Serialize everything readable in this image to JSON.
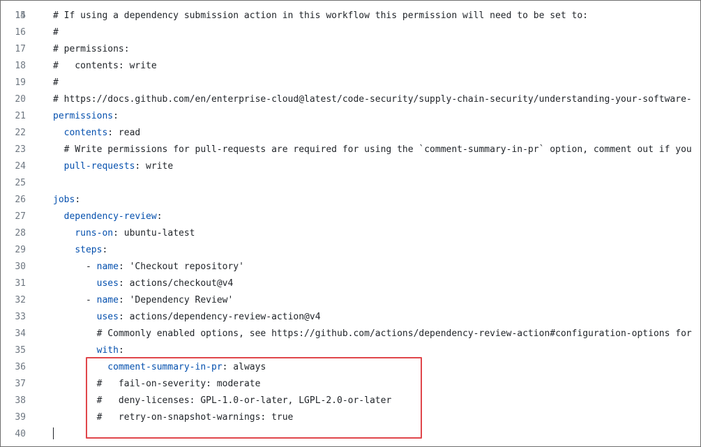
{
  "editor": {
    "first_partial_line": "14",
    "lines": [
      {
        "num": "15",
        "indent": "",
        "parts": [
          {
            "t": "# If using a dependency submission action in this workflow this permission will need to be set to:",
            "c": "cmt"
          }
        ]
      },
      {
        "num": "16",
        "indent": "",
        "parts": [
          {
            "t": "#",
            "c": "cmt"
          }
        ]
      },
      {
        "num": "17",
        "indent": "",
        "parts": [
          {
            "t": "# permissions:",
            "c": "cmt"
          }
        ]
      },
      {
        "num": "18",
        "indent": "",
        "parts": [
          {
            "t": "#   contents: write",
            "c": "cmt"
          }
        ]
      },
      {
        "num": "19",
        "indent": "",
        "parts": [
          {
            "t": "#",
            "c": "cmt"
          }
        ]
      },
      {
        "num": "20",
        "indent": "",
        "parts": [
          {
            "t": "# https://docs.github.com/en/enterprise-cloud@latest/code-security/supply-chain-security/understanding-your-software-",
            "c": "cmt"
          }
        ]
      },
      {
        "num": "21",
        "indent": "",
        "parts": [
          {
            "t": "permissions",
            "c": "key"
          },
          {
            "t": ":",
            "c": "val"
          }
        ]
      },
      {
        "num": "22",
        "indent": "  ",
        "parts": [
          {
            "t": "contents",
            "c": "key"
          },
          {
            "t": ": read",
            "c": "val"
          }
        ]
      },
      {
        "num": "23",
        "indent": "  ",
        "parts": [
          {
            "t": "# Write permissions for pull-requests are required for using the `comment-summary-in-pr` option, comment out if you",
            "c": "cmt"
          }
        ]
      },
      {
        "num": "24",
        "indent": "  ",
        "parts": [
          {
            "t": "pull-requests",
            "c": "key"
          },
          {
            "t": ": write",
            "c": "val"
          }
        ]
      },
      {
        "num": "25",
        "indent": "",
        "parts": []
      },
      {
        "num": "26",
        "indent": "",
        "parts": [
          {
            "t": "jobs",
            "c": "key"
          },
          {
            "t": ":",
            "c": "val"
          }
        ]
      },
      {
        "num": "27",
        "indent": "  ",
        "parts": [
          {
            "t": "dependency-review",
            "c": "key"
          },
          {
            "t": ":",
            "c": "val"
          }
        ]
      },
      {
        "num": "28",
        "indent": "    ",
        "parts": [
          {
            "t": "runs-on",
            "c": "key"
          },
          {
            "t": ": ubuntu-latest",
            "c": "val"
          }
        ]
      },
      {
        "num": "29",
        "indent": "    ",
        "parts": [
          {
            "t": "steps",
            "c": "key"
          },
          {
            "t": ":",
            "c": "val"
          }
        ]
      },
      {
        "num": "30",
        "indent": "      ",
        "parts": [
          {
            "t": "- ",
            "c": "val"
          },
          {
            "t": "name",
            "c": "key"
          },
          {
            "t": ": 'Checkout repository'",
            "c": "val"
          }
        ]
      },
      {
        "num": "31",
        "indent": "        ",
        "parts": [
          {
            "t": "uses",
            "c": "key"
          },
          {
            "t": ": actions/checkout@v4",
            "c": "val"
          }
        ]
      },
      {
        "num": "32",
        "indent": "      ",
        "parts": [
          {
            "t": "- ",
            "c": "val"
          },
          {
            "t": "name",
            "c": "key"
          },
          {
            "t": ": 'Dependency Review'",
            "c": "val"
          }
        ]
      },
      {
        "num": "33",
        "indent": "        ",
        "parts": [
          {
            "t": "uses",
            "c": "key"
          },
          {
            "t": ": actions/dependency-review-action@v4",
            "c": "val"
          }
        ]
      },
      {
        "num": "34",
        "indent": "        ",
        "parts": [
          {
            "t": "# Commonly enabled options, see https://github.com/actions/dependency-review-action#configuration-options for",
            "c": "cmt"
          }
        ]
      },
      {
        "num": "35",
        "indent": "        ",
        "parts": [
          {
            "t": "with",
            "c": "key"
          },
          {
            "t": ":",
            "c": "val"
          }
        ]
      },
      {
        "num": "36",
        "indent": "          ",
        "parts": [
          {
            "t": "comment-summary-in-pr",
            "c": "key"
          },
          {
            "t": ": always",
            "c": "val"
          }
        ]
      },
      {
        "num": "37",
        "indent": "        ",
        "parts": [
          {
            "t": "#   fail-on-severity: moderate",
            "c": "cmt"
          }
        ]
      },
      {
        "num": "38",
        "indent": "        ",
        "parts": [
          {
            "t": "#   deny-licenses: GPL-1.0-or-later, LGPL-2.0-or-later",
            "c": "cmt"
          }
        ]
      },
      {
        "num": "39",
        "indent": "        ",
        "parts": [
          {
            "t": "#   retry-on-snapshot-warnings: true",
            "c": "cmt"
          }
        ]
      },
      {
        "num": "40",
        "indent": "",
        "parts": []
      }
    ]
  },
  "colors": {
    "key": "#0550ae",
    "text": "#1f2328",
    "line_number": "#6e7781",
    "highlight_border": "#e0464b"
  }
}
